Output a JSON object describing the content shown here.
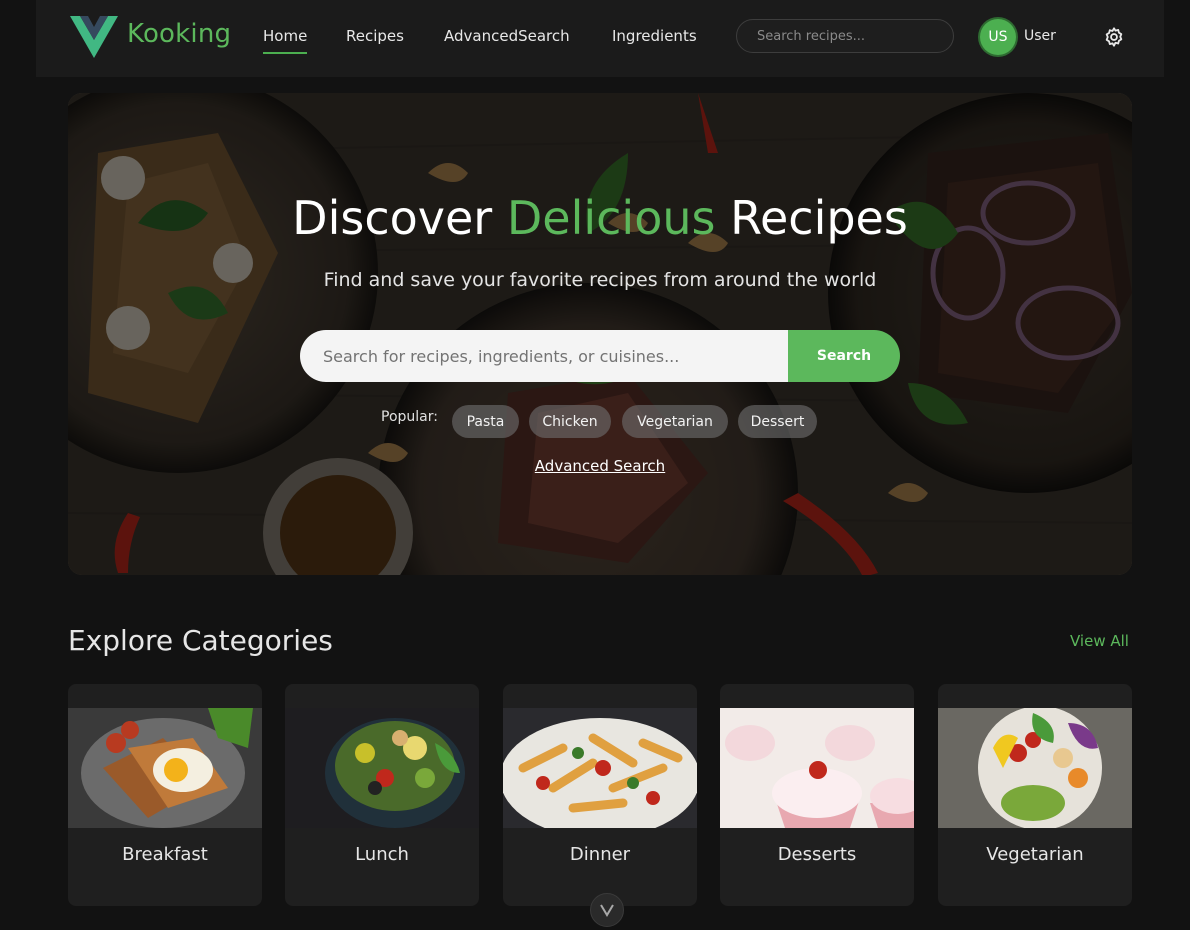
{
  "brand": {
    "name": "Kooking",
    "accent_color": "#5cb85c",
    "logo_icon": "vue-logo"
  },
  "nav": {
    "links": [
      "Home",
      "Recipes",
      "AdvancedSearch",
      "Ingredients"
    ],
    "active": "Home",
    "search_placeholder": "Search recipes...",
    "avatar_initials": "US",
    "user_label": "User",
    "settings_icon": "gear-icon"
  },
  "hero": {
    "title_prefix": "Discover ",
    "title_accent": "Delicious",
    "title_suffix": " Recipes",
    "subtitle": "Find and save your favorite recipes from around the world",
    "search_placeholder": "Search for recipes, ingredients, or cuisines...",
    "search_button": "Search",
    "popular_label": "Popular:",
    "popular_tags": [
      "Pasta",
      "Chicken",
      "Vegetarian",
      "Dessert"
    ],
    "advanced_link": "Advanced Search"
  },
  "categories": {
    "title": "Explore Categories",
    "view_all": "View All",
    "items": [
      "Breakfast",
      "Lunch",
      "Dinner",
      "Desserts",
      "Vegetarian"
    ]
  }
}
